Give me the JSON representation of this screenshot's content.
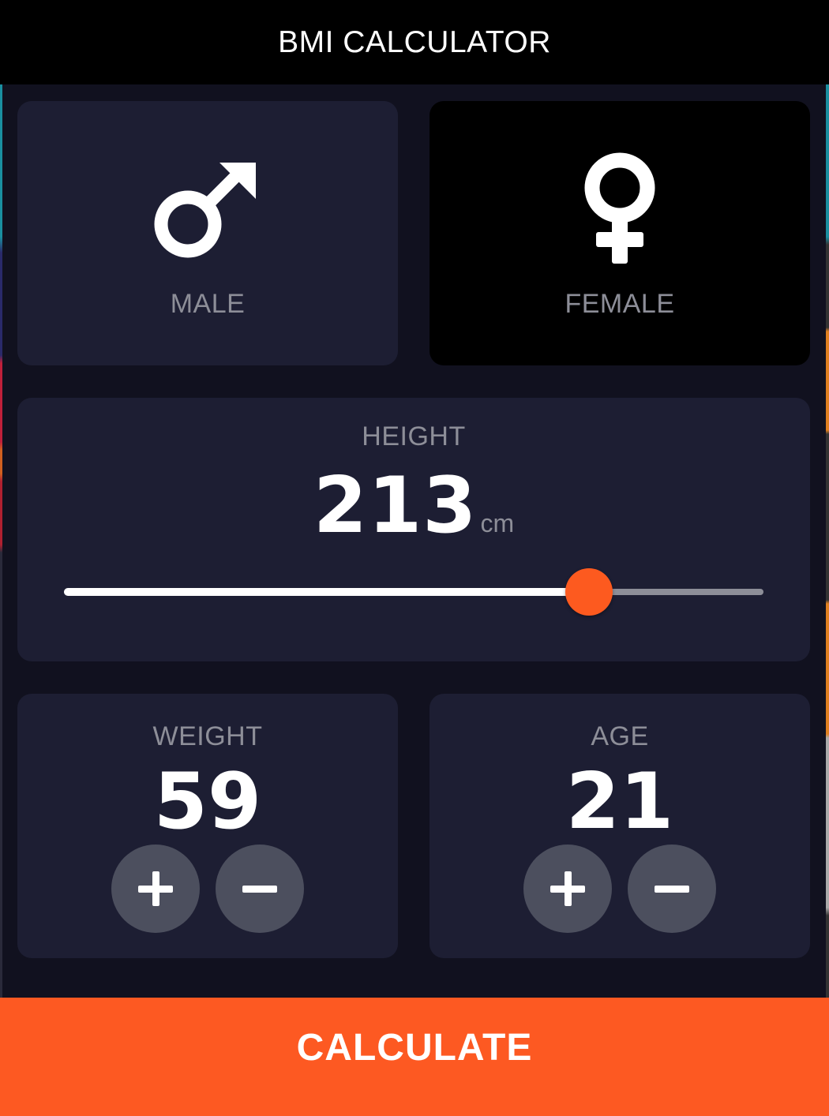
{
  "appbar": {
    "title": "BMI CALCULATOR"
  },
  "gender": {
    "male": {
      "label": "MALE",
      "icon": "male-symbol-icon",
      "selected": false
    },
    "female": {
      "label": "FEMALE",
      "icon": "female-symbol-icon",
      "selected": true
    }
  },
  "height": {
    "label": "HEIGHT",
    "value": "213",
    "unit": "cm",
    "slider_fraction": 0.75
  },
  "weight": {
    "label": "WEIGHT",
    "value": "59"
  },
  "age": {
    "label": "AGE",
    "value": "21"
  },
  "buttons": {
    "plus_icon": "plus-icon",
    "minus_icon": "minus-icon"
  },
  "calculate": {
    "label": "CALCULATE"
  },
  "colors": {
    "background": "#11111f",
    "card": "#1d1e33",
    "card_selected": "#000000",
    "accent": "#fd5a1f",
    "label_gray": "#8d8e98",
    "round_button": "#4c4f5e"
  }
}
